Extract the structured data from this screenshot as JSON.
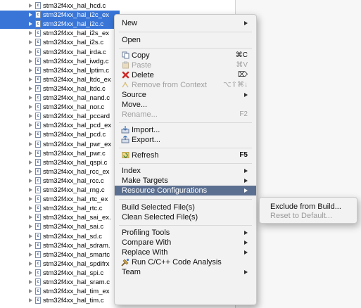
{
  "tree": {
    "files": [
      {
        "name": "stm32f4xx_hal_hcd.c",
        "selected": false
      },
      {
        "name": "stm32f4xx_hal_i2c_ex",
        "selected": true
      },
      {
        "name": "stm32f4xx_hal_i2c.c",
        "selected": true
      },
      {
        "name": "stm32f4xx_hal_i2s_ex",
        "selected": false
      },
      {
        "name": "stm32f4xx_hal_i2s.c",
        "selected": false
      },
      {
        "name": "stm32f4xx_hal_irda.c",
        "selected": false
      },
      {
        "name": "stm32f4xx_hal_iwdg.c",
        "selected": false
      },
      {
        "name": "stm32f4xx_hal_lptim.c",
        "selected": false
      },
      {
        "name": "stm32f4xx_hal_ltdc_ex",
        "selected": false
      },
      {
        "name": "stm32f4xx_hal_ltdc.c",
        "selected": false
      },
      {
        "name": "stm32f4xx_hal_nand.c",
        "selected": false
      },
      {
        "name": "stm32f4xx_hal_nor.c",
        "selected": false
      },
      {
        "name": "stm32f4xx_hal_pccard",
        "selected": false
      },
      {
        "name": "stm32f4xx_hal_pcd_ex",
        "selected": false
      },
      {
        "name": "stm32f4xx_hal_pcd.c",
        "selected": false
      },
      {
        "name": "stm32f4xx_hal_pwr_ex",
        "selected": false
      },
      {
        "name": "stm32f4xx_hal_pwr.c",
        "selected": false
      },
      {
        "name": "stm32f4xx_hal_qspi.c",
        "selected": false
      },
      {
        "name": "stm32f4xx_hal_rcc_ex",
        "selected": false
      },
      {
        "name": "stm32f4xx_hal_rcc.c",
        "selected": false
      },
      {
        "name": "stm32f4xx_hal_rng.c",
        "selected": false
      },
      {
        "name": "stm32f4xx_hal_rtc_ex",
        "selected": false
      },
      {
        "name": "stm32f4xx_hal_rtc.c",
        "selected": false
      },
      {
        "name": "stm32f4xx_hal_sai_ex.",
        "selected": false
      },
      {
        "name": "stm32f4xx_hal_sai.c",
        "selected": false
      },
      {
        "name": "stm32f4xx_hal_sd.c",
        "selected": false
      },
      {
        "name": "stm32f4xx_hal_sdram.",
        "selected": false
      },
      {
        "name": "stm32f4xx_hal_smartc",
        "selected": false
      },
      {
        "name": "stm32f4xx_hal_spdifrx",
        "selected": false
      },
      {
        "name": "stm32f4xx_hal_spi.c",
        "selected": false
      },
      {
        "name": "stm32f4xx_hal_sram.c",
        "selected": false
      },
      {
        "name": "stm32f4xx_hal_tim_ex",
        "selected": false
      },
      {
        "name": "stm32f4xx_hal_tim.c",
        "selected": false
      }
    ]
  },
  "menu": {
    "new": "New",
    "open": "Open",
    "copy": "Copy",
    "copy_sc": "⌘C",
    "paste": "Paste",
    "paste_sc": "⌘V",
    "delete": "Delete",
    "delete_sc": "⌦",
    "remove_ctx": "Remove from Context",
    "remove_ctx_sc": "⌥⇧⌘↓",
    "source": "Source",
    "move": "Move...",
    "rename": "Rename...",
    "rename_sc": "F2",
    "import": "Import...",
    "export": "Export...",
    "refresh": "Refresh",
    "refresh_sc": "F5",
    "index": "Index",
    "make_targets": "Make Targets",
    "resource_configs": "Resource Configurations",
    "build_selected": "Build Selected File(s)",
    "clean_selected": "Clean Selected File(s)",
    "profiling": "Profiling Tools",
    "compare": "Compare With",
    "replace": "Replace With",
    "run_analysis": "Run C/C++ Code Analysis",
    "team": "Team"
  },
  "submenu": {
    "exclude": "Exclude from Build...",
    "reset": "Reset to Default..."
  },
  "icons": {
    "file": "c-file-icon",
    "copy": "copy-icon",
    "paste": "paste-icon",
    "delete": "delete-icon",
    "remove_ctx": "remove-context-icon",
    "import": "import-icon",
    "export": "export-icon",
    "refresh": "refresh-icon",
    "run_analysis": "code-analysis-icon"
  },
  "colors": {
    "selection": "#3875d7",
    "menu_highlight": "#5b6f90",
    "delete_red": "#d02a2a"
  }
}
